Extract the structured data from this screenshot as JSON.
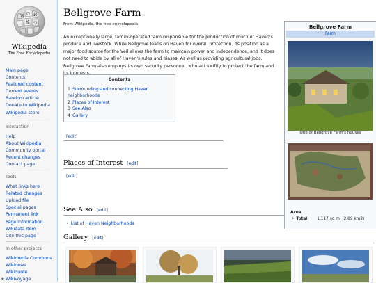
{
  "logo": {
    "wordmark": "Wikipedia",
    "tagline": "The Free Encyclopedia"
  },
  "sidebar": {
    "main": [
      "Main page",
      "Contents",
      "Featured content",
      "Current events",
      "Random article",
      "Donate to Wikipedia",
      "Wikipedia store"
    ],
    "interaction": {
      "heading": "Interaction",
      "items": [
        "Help",
        "About Wikipedia",
        "Community portal",
        "Recent changes",
        "Contact page"
      ]
    },
    "tools": {
      "heading": "Tools",
      "items": [
        "What links here",
        "Related changes",
        "Upload file",
        "Special pages",
        "Permanent link",
        "Page information",
        "Wikidata item",
        "Cite this page"
      ]
    },
    "other": {
      "heading": "In other projects",
      "items": [
        "Wikimedia Commons",
        "Wikinews",
        "Wikiquote",
        "Wikivoyage"
      ]
    }
  },
  "article": {
    "title": "Bellgrove Farm",
    "subtitle": "From Wikipedia, the free encyclopedia",
    "intro": "An exceptionally large, family-operated farm responsible for the production of much of Haven's produce and livestock. While Bellgrove leans on Haven for overall protection, its position as a major food source for the Veil allows the farm to maintain power and independence, and it does not need to abide by all of Haven's rules and biases. As well as providing agricultural jobs, Bellgrove Farm also employs its own security personnel, who act swiftly to protect the farm and its interests.",
    "toc": {
      "title": "Contents",
      "items": [
        {
          "num": "1",
          "label": "Surrounding and connecting Haven neighborhoods"
        },
        {
          "num": "2",
          "label": "Places of Interest"
        },
        {
          "num": "3",
          "label": "See Also"
        },
        {
          "num": "4",
          "label": "Gallery"
        }
      ]
    },
    "edit_label": "edit",
    "sections": {
      "places": "Places of Interest",
      "see_also": "See Also",
      "gallery": "Gallery"
    },
    "see_also_items": [
      "List of Haven Neighborhoods"
    ]
  },
  "infobox": {
    "title": "Bellgrove Farm",
    "type": "Farm",
    "caption": "One of Bellgrove Farm's houses",
    "area_label": "Area",
    "total_label": "Total",
    "total_value": "1.117 sq mi (2.89 km2)"
  },
  "colors": {
    "link": "#0645ad",
    "infobox_header": "#c6d9f1",
    "border": "#a2a9b1"
  }
}
